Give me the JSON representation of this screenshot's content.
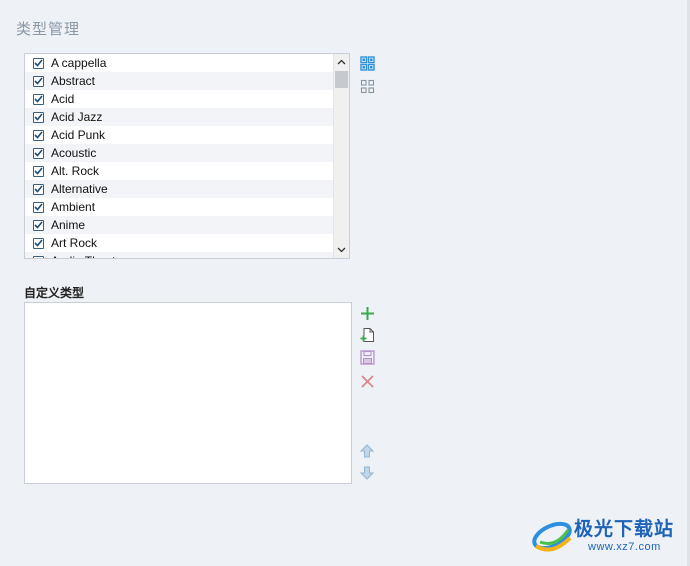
{
  "page": {
    "title": "类型管理"
  },
  "genres": {
    "items": [
      {
        "label": "A cappella",
        "checked": true
      },
      {
        "label": "Abstract",
        "checked": true
      },
      {
        "label": "Acid",
        "checked": true
      },
      {
        "label": "Acid Jazz",
        "checked": true
      },
      {
        "label": "Acid Punk",
        "checked": true
      },
      {
        "label": "Acoustic",
        "checked": true
      },
      {
        "label": "Alt. Rock",
        "checked": true
      },
      {
        "label": "Alternative",
        "checked": true
      },
      {
        "label": "Ambient",
        "checked": true
      },
      {
        "label": "Anime",
        "checked": true
      },
      {
        "label": "Art Rock",
        "checked": true
      },
      {
        "label": "Audio Theatre",
        "checked": false
      }
    ],
    "side_icons": [
      "check-all-icon",
      "uncheck-all-icon"
    ]
  },
  "custom": {
    "label": "自定义类型",
    "side_icons": [
      "add-icon",
      "new-file-icon",
      "save-icon",
      "delete-icon",
      "move-up-icon",
      "move-down-icon"
    ]
  },
  "watermark": {
    "text": "极光下载站",
    "url": "www.xz7.com"
  },
  "colors": {
    "accent_blue": "#2f8fd8",
    "add_green": "#3aa84a",
    "save_purple": "#b591c9",
    "delete_red": "#d48a8a",
    "arrow_blue": "#8fb6d4"
  }
}
